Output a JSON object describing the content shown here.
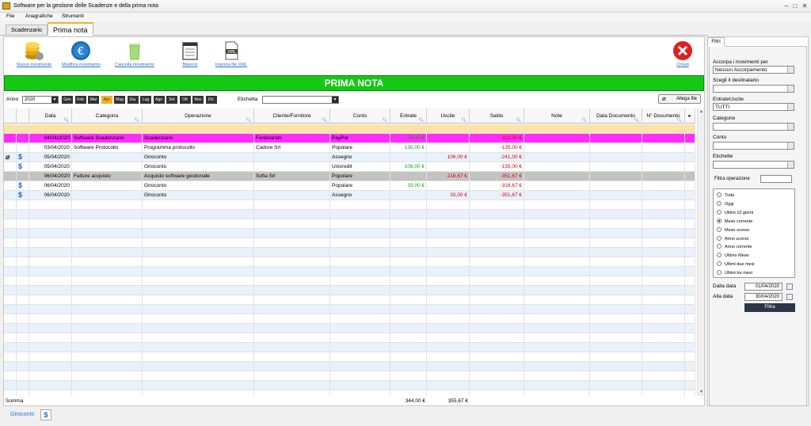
{
  "window": {
    "title": "Software per la gestione delle Scadenze e della prima nota"
  },
  "menu": [
    "File",
    "Anagrafiche",
    "Strumenti"
  ],
  "tabs": [
    {
      "label": "Scadenzario"
    },
    {
      "label": "Prima nota"
    }
  ],
  "toolbar": {
    "new": "Nuovo movimento",
    "edit": "Modifica movimento",
    "delete": "Cancella movimento",
    "balance": "Bilancio",
    "import": "Importa file XML",
    "import_badge": "XML",
    "close": "Chiudi"
  },
  "banner": "PRIMA NOTA",
  "filters": {
    "year_label": "Anno",
    "year": "2020",
    "months": [
      "Gen",
      "Feb",
      "Mar",
      "Apr",
      "Mag",
      "Giu",
      "Lug",
      "Ago",
      "Set",
      "Ott",
      "Nov",
      "Dic"
    ],
    "active_month": "Apr",
    "tag_label": "Etichetta",
    "attach_button": "Allega file"
  },
  "columns": [
    "Data",
    "Categoria",
    "Operazione",
    "Cliente/Fornitore",
    "Conto",
    "Entrate",
    "Uscite",
    "Saldo",
    "Note",
    "Data Documento",
    "N° Documento"
  ],
  "rows": [
    {
      "style": "magenta",
      "data": "04/04/2020",
      "categoria": "Software Scadenzario",
      "operazione": "Scadenzario",
      "cliente": "Ferdinando",
      "conto": "PayPal",
      "entrate": "78,00 €",
      "uscite": "",
      "saldo": "-313,00 €",
      "icons": []
    },
    {
      "style": "normal",
      "data": "03/04/2020",
      "categoria": "Software Protocollo",
      "operazione": "Programma protocollo",
      "cliente": "Cadore Srl",
      "conto": "Popolare",
      "entrate": "130,00 €",
      "uscite": "",
      "saldo": "-135,00 €",
      "icons": []
    },
    {
      "style": "normal",
      "data": "05/04/2020",
      "categoria": "",
      "operazione": "Giroconto",
      "cliente": "",
      "conto": "Assegno",
      "entrate": "",
      "uscite": "106,00 €",
      "saldo": "-241,00 €",
      "icons": [
        "paperclip-icon",
        "transfer-icon"
      ]
    },
    {
      "style": "normal",
      "data": "05/04/2020",
      "categoria": "",
      "operazione": "Giroconto",
      "cliente": "",
      "conto": "Unicredit",
      "entrate": "106,00 €",
      "uscite": "",
      "saldo": "-135,00 €",
      "icons": [
        "transfer-icon"
      ]
    },
    {
      "style": "gray",
      "data": "06/04/2020",
      "categoria": "Fatture acquisto",
      "operazione": "Acquisto software gestionale",
      "cliente": "Sofia Srl",
      "conto": "Popolare",
      "entrate": "",
      "uscite": "216,67 €",
      "saldo": "-351,67 €",
      "icons": []
    },
    {
      "style": "normal",
      "data": "06/04/2020",
      "categoria": "",
      "operazione": "Giroconto",
      "cliente": "",
      "conto": "Popolare",
      "entrate": "33,00 €",
      "uscite": "",
      "saldo": "-318,67 €",
      "icons": [
        "transfer-icon"
      ]
    },
    {
      "style": "normal",
      "data": "06/04/2020",
      "categoria": "",
      "operazione": "Giroconto",
      "cliente": "",
      "conto": "Assegno",
      "entrate": "",
      "uscite": "33,00 €",
      "saldo": "-351,67 €",
      "icons": [
        "transfer-icon"
      ]
    }
  ],
  "totals": {
    "label": "Somma",
    "entrate": "344,00 €",
    "uscite": "355,67 €"
  },
  "status": {
    "legend": "Giroconto"
  },
  "side": {
    "tab": "Filtri",
    "match_label": "Accorpa i movimenti per",
    "match_value": "Nessun Accorpamento",
    "recipient_label": "Scegli il destinatario",
    "type_label": "EntrateUscite",
    "type_value": "TUTTI",
    "category_label": "Categorie",
    "account_label": "Conto",
    "tags_label": "Etichette",
    "op_filter_label": "Filtra operazione",
    "periods": [
      "Tutte",
      "Oggi",
      "Ultimi 10 giorni",
      "Mese corrente",
      "Mese scorso",
      "Anno scorso",
      "Anno corrente",
      "Ultimo Mese",
      "Ultimi due mesi",
      "Ultimi tre mesi"
    ],
    "selected_period": "Mese corrente",
    "from_label": "Dalla data",
    "from_value": "01/04/2020",
    "to_label": "Alla data",
    "to_value": "30/04/2020",
    "filter_button": "Filtra"
  }
}
